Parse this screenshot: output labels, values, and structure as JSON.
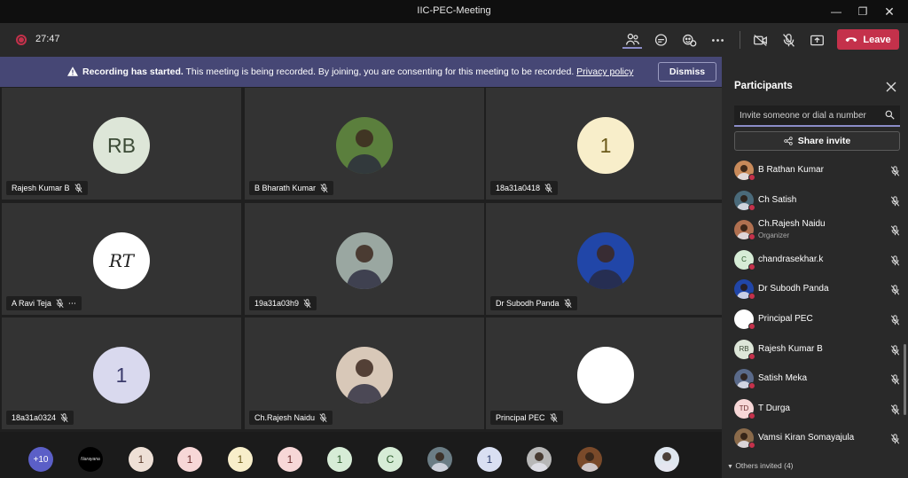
{
  "window": {
    "title": "IIC-PEC-Meeting"
  },
  "toolbar": {
    "timer": "27:47",
    "leave_label": "Leave"
  },
  "banner": {
    "bold": "Recording has started.",
    "message": " This meeting is being recorded. By joining, you are consenting for this meeting to be recorded. ",
    "link": "Privacy policy",
    "dismiss_label": "Dismiss"
  },
  "tiles": [
    {
      "name": "Rajesh Kumar B",
      "avatar": "RB",
      "bg": "#dde6d8",
      "fg": "#3b4a35"
    },
    {
      "name": "B Bharath Kumar",
      "avatar": "",
      "bg": "#5b7f3d",
      "fg": "#fff"
    },
    {
      "name": "18a31a0418",
      "avatar": "1",
      "bg": "#f8eeca",
      "fg": "#6b5a1a"
    },
    {
      "name": "A Ravi Teja",
      "avatar": "RT",
      "bg": "#ffffff",
      "fg": "#222"
    },
    {
      "name": "19a31a03h9",
      "avatar": "",
      "bg": "#9aa7a1",
      "fg": "#fff"
    },
    {
      "name": "Dr Subodh Panda",
      "avatar": "",
      "bg": "#2146a8",
      "fg": "#fff"
    },
    {
      "name": "18a31a0324",
      "avatar": "1",
      "bg": "#d9d9ee",
      "fg": "#3b3b6b"
    },
    {
      "name": "Ch.Rajesh Naidu",
      "avatar": "",
      "bg": "#d8c8b8",
      "fg": "#fff"
    },
    {
      "name": "Principal PEC",
      "avatar": "",
      "bg": "#ffffff",
      "fg": "#fff"
    }
  ],
  "strip": [
    {
      "text": "+10",
      "bg": "#5b5fc7",
      "fg": "#fff"
    },
    {
      "text": "Narayana",
      "bg": "#000000",
      "fg": "#ddd"
    },
    {
      "text": "1",
      "bg": "#eee0d6",
      "fg": "#5a3b2b"
    },
    {
      "text": "1",
      "bg": "#f7d7d7",
      "fg": "#6b2b2b"
    },
    {
      "text": "1",
      "bg": "#f8eeca",
      "fg": "#6b5a1a"
    },
    {
      "text": "1",
      "bg": "#f7d7d7",
      "fg": "#6b2b2b"
    },
    {
      "text": "1",
      "bg": "#d6ecd6",
      "fg": "#2b5a2b"
    },
    {
      "text": "C",
      "bg": "#d6ecd6",
      "fg": "#2b5a2b"
    },
    {
      "text": "",
      "bg": "#6b7d85",
      "fg": "#fff"
    },
    {
      "text": "1",
      "bg": "#d9dff2",
      "fg": "#2b3b6b"
    },
    {
      "text": "",
      "bg": "#b8b8b8",
      "fg": "#fff"
    },
    {
      "text": "",
      "bg": "#7a4a2a",
      "fg": "#fff"
    },
    {
      "text": "",
      "bg": "#dfe6ef",
      "fg": "#fff"
    }
  ],
  "panel": {
    "title": "Participants",
    "search_placeholder": "Invite someone or dial a number",
    "share_label": "Share invite",
    "participants": [
      {
        "name": "B Rathan Kumar",
        "initials": "",
        "bg": "#c88a5a",
        "fg": "#fff",
        "role": ""
      },
      {
        "name": "Ch Satish",
        "initials": "",
        "bg": "#4a6a7a",
        "fg": "#fff",
        "role": ""
      },
      {
        "name": "Ch.Rajesh Naidu",
        "initials": "",
        "bg": "#b07050",
        "fg": "#fff",
        "role": "Organizer"
      },
      {
        "name": "chandrasekhar.k",
        "initials": "C",
        "bg": "#d6ecd6",
        "fg": "#2b5a2b",
        "role": ""
      },
      {
        "name": "Dr Subodh Panda",
        "initials": "",
        "bg": "#2146a8",
        "fg": "#fff",
        "role": ""
      },
      {
        "name": "Principal PEC",
        "initials": "",
        "bg": "#ffffff",
        "fg": "#333",
        "role": ""
      },
      {
        "name": "Rajesh Kumar B",
        "initials": "RB",
        "bg": "#dde6d8",
        "fg": "#3b4a35",
        "role": ""
      },
      {
        "name": "Satish Meka",
        "initials": "",
        "bg": "#5a6a8a",
        "fg": "#fff",
        "role": ""
      },
      {
        "name": "T Durga",
        "initials": "TD",
        "bg": "#f7d7d7",
        "fg": "#6b2b2b",
        "role": ""
      },
      {
        "name": "Vamsi Kiran Somayajula",
        "initials": "",
        "bg": "#8a6a4a",
        "fg": "#fff",
        "role": ""
      }
    ],
    "others": "Others invited (4)"
  },
  "icons": {
    "record": "record-icon",
    "participants": "people-icon",
    "chat": "chat-icon",
    "reactions": "reactions-icon",
    "more": "more-icon",
    "camera": "camera-off-icon",
    "mic": "mic-off-icon",
    "share": "share-screen-icon",
    "leave": "phone-hangup-icon"
  },
  "colors": {
    "accent": "#8b8cc7",
    "danger": "#c4314b",
    "banner": "#464775"
  }
}
